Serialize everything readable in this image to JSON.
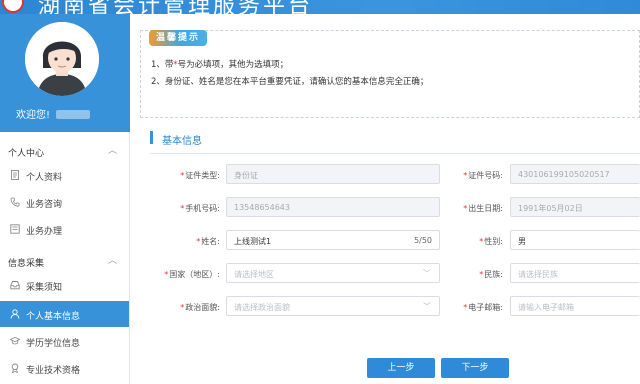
{
  "header": {
    "title": "湖南省会计管理服务平台"
  },
  "profile": {
    "welcome": "欢迎您!"
  },
  "sidebar": {
    "groups": [
      {
        "label": "个人中心",
        "items": [
          {
            "label": "个人资料",
            "icon": "document-icon"
          },
          {
            "label": "业务咨询",
            "icon": "phone-icon"
          },
          {
            "label": "业务办理",
            "icon": "form-icon"
          }
        ]
      },
      {
        "label": "信息采集",
        "items": [
          {
            "label": "采集须知",
            "icon": "inbox-icon"
          },
          {
            "label": "个人基本信息",
            "icon": "user-icon",
            "active": true
          },
          {
            "label": "学历学位信息",
            "icon": "graduation-cap-icon"
          },
          {
            "label": "专业技术资格",
            "icon": "award-icon"
          }
        ]
      }
    ]
  },
  "notice": {
    "badge": "温馨提示",
    "line1_prefix": "1、带",
    "line1_star": "*",
    "line1_suffix": "号为必填项，其他为选填项；",
    "line2": "2、身份证、姓名是您在本平台重要凭证，请确认您的基本信息完全正确；"
  },
  "section": {
    "title": "基本信息"
  },
  "form": {
    "id_type": {
      "label": "证件类型:",
      "value": "身份证"
    },
    "id_number": {
      "label": "证件号码:",
      "value": "430106199105020517"
    },
    "phone": {
      "label": "手机号码:",
      "value": "13548654643"
    },
    "birth": {
      "label": "出生日期:",
      "value": "1991年05月02日"
    },
    "name": {
      "label": "姓名:",
      "value": "上线测试1",
      "counter": "5/50"
    },
    "gender": {
      "label": "性别:",
      "value": "男"
    },
    "country": {
      "label": "国家（地区）:",
      "placeholder": "请选择地区"
    },
    "ethnicity": {
      "label": "民族:",
      "placeholder": "请选择民族"
    },
    "political": {
      "label": "政治面貌:",
      "placeholder": "请选择政治面貌"
    },
    "email": {
      "label": "电子邮箱:",
      "placeholder": "请输入电子邮箱"
    }
  },
  "buttons": {
    "prev": "上一步",
    "next": "下一步"
  },
  "colors": {
    "primary": "#3792d9",
    "required": "#e33333"
  }
}
